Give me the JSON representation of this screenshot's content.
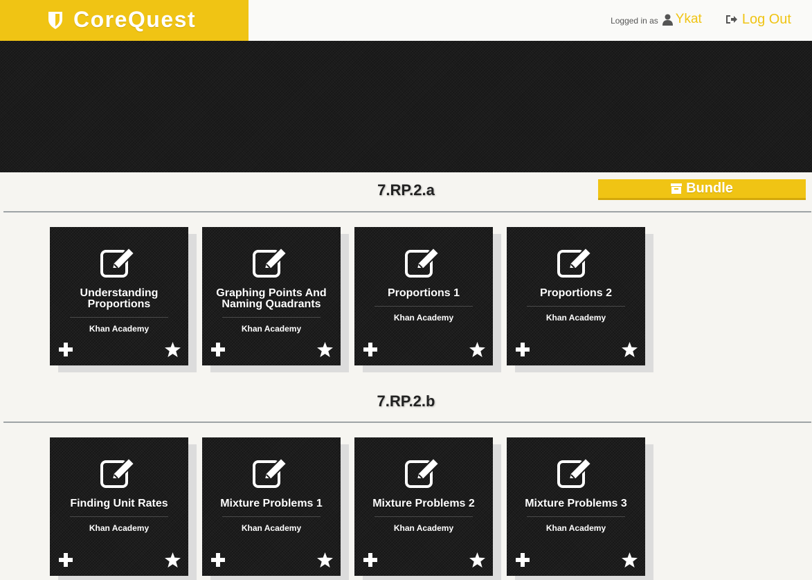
{
  "header": {
    "app_title": "CoreQuest",
    "logo_icon": "shield-icon",
    "logged_in_label": "Logged in as",
    "username": "Ykat",
    "logout_label": "Log Out",
    "brand_color": "#f0c414"
  },
  "sections": [
    {
      "title": "7.RP.2.a",
      "bundle_label": "Bundle",
      "cards": [
        {
          "title": "Understanding Proportions",
          "source": "Khan Academy"
        },
        {
          "title": "Graphing Points And Naming Quadrants",
          "source": "Khan Academy"
        },
        {
          "title": "Proportions 1",
          "source": "Khan Academy"
        },
        {
          "title": "Proportions 2",
          "source": "Khan Academy"
        }
      ]
    },
    {
      "title": "7.RP.2.b",
      "cards": [
        {
          "title": "Finding Unit Rates",
          "source": "Khan Academy"
        },
        {
          "title": "Mixture Problems 1",
          "source": "Khan Academy"
        },
        {
          "title": "Mixture Problems 2",
          "source": "Khan Academy"
        },
        {
          "title": "Mixture Problems 3",
          "source": "Khan Academy"
        }
      ]
    }
  ]
}
